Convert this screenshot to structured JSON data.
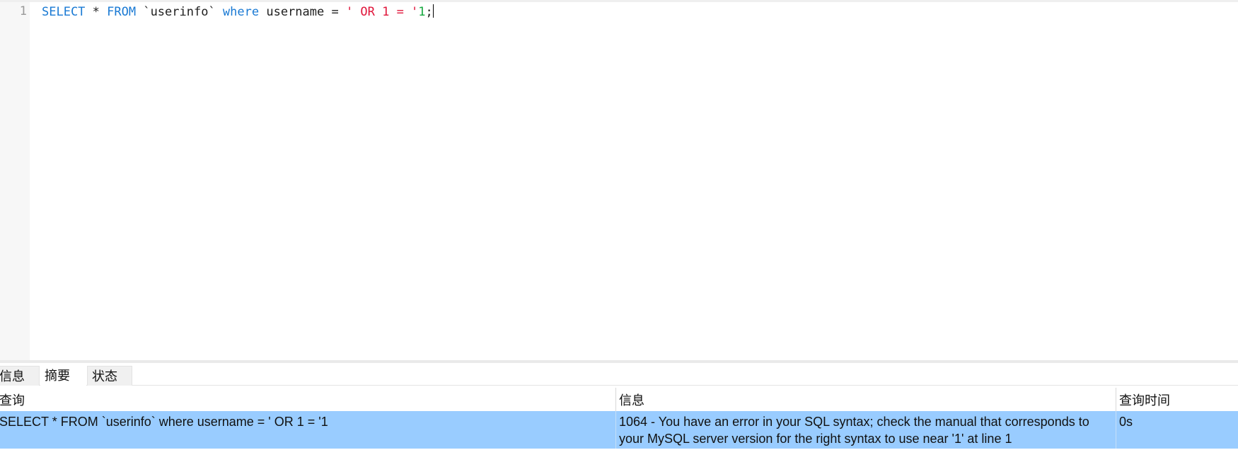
{
  "editor": {
    "line_number": "1",
    "tokens": [
      {
        "text": "SELECT",
        "cls": "tok-kw"
      },
      {
        "text": " * ",
        "cls": "tok-plain"
      },
      {
        "text": "FROM",
        "cls": "tok-kw"
      },
      {
        "text": " `userinfo` ",
        "cls": "tok-plain"
      },
      {
        "text": "where",
        "cls": "tok-kw"
      },
      {
        "text": " username = ",
        "cls": "tok-plain"
      },
      {
        "text": "' OR 1 = '",
        "cls": "tok-str"
      },
      {
        "text": "1",
        "cls": "tok-num"
      },
      {
        "text": ";",
        "cls": "tok-plain"
      }
    ]
  },
  "tabs": {
    "info": "信息",
    "summary": "摘要",
    "status": "状态"
  },
  "grid": {
    "headers": {
      "query": "查询",
      "message": "信息",
      "query_time": "查询时间"
    },
    "row": {
      "query": "SELECT * FROM `userinfo` where username = ' OR 1 = '1",
      "message": "1064 - You have an error in your SQL syntax; check the manual that corresponds to your MySQL server version for the right syntax to use near '1' at line 1",
      "query_time": "0s"
    }
  },
  "colors": {
    "keyword": "#1a7ad4",
    "string": "#e0153a",
    "number": "#15a83e",
    "selected_row": "#99ccff"
  }
}
